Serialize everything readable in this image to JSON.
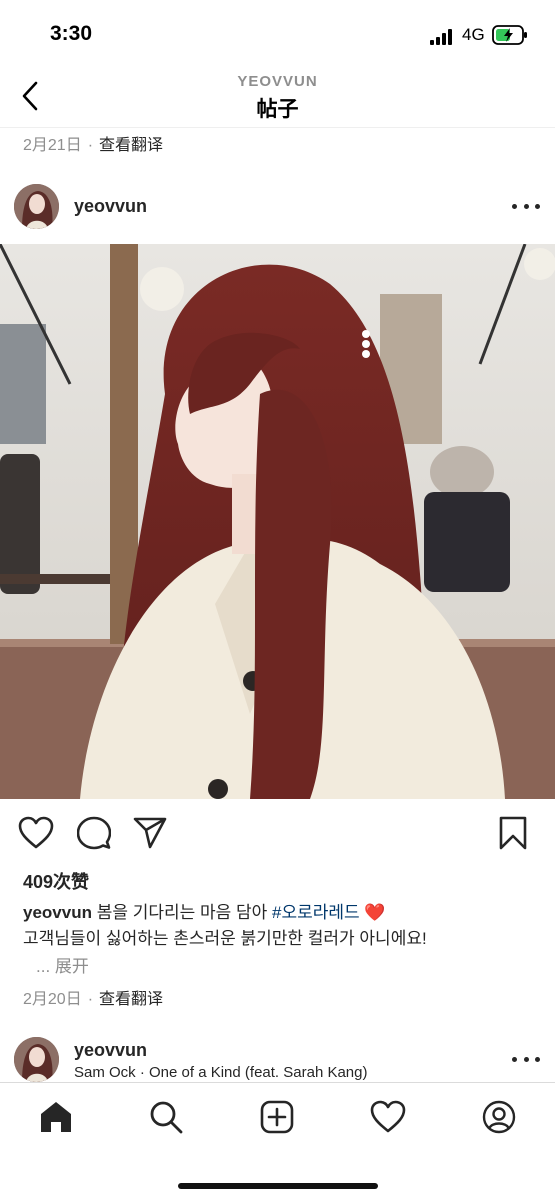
{
  "status_bar": {
    "time": "3:30",
    "network": "4G",
    "icons": [
      "signal-icon",
      "battery-charging-icon"
    ]
  },
  "header": {
    "account": "YEOVVUN",
    "title": "帖子",
    "back_icon": "chevron-left-icon"
  },
  "previous_post": {
    "date": "2月21日",
    "separator": "·",
    "translate": "查看翻译"
  },
  "post": {
    "username": "yeovvun",
    "more_icon": "more-horizontal-icon",
    "photo_description_icon": "photo",
    "actions": [
      "heart-icon",
      "comment-icon",
      "share-icon",
      "bookmark-icon"
    ],
    "likes": "409次赞",
    "caption": {
      "username": "yeovvun",
      "text_before_tag": " 봄을 기다리는 마음 담아 ",
      "hashtag": "#오로라레드",
      "emoji": " ❤️",
      "line2": "고객님들이 싫어하는 촌스러운 붉기만한 컬러가 아니에요!"
    },
    "expand": "... 展开",
    "date": "2月20日",
    "separator": "·",
    "translate": "查看翻译"
  },
  "next_post": {
    "username": "yeovvun",
    "music": "Sam Ock · One of a Kind (feat. Sarah Kang)"
  },
  "tab_bar": {
    "tabs": [
      "home-icon",
      "search-icon",
      "create-icon",
      "activity-icon",
      "profile-icon"
    ]
  },
  "colors": {
    "text": "#262626",
    "secondary": "#8e8e8e",
    "hashtag": "#00376b",
    "heart": "#e0245e",
    "battery": "#34c759"
  }
}
